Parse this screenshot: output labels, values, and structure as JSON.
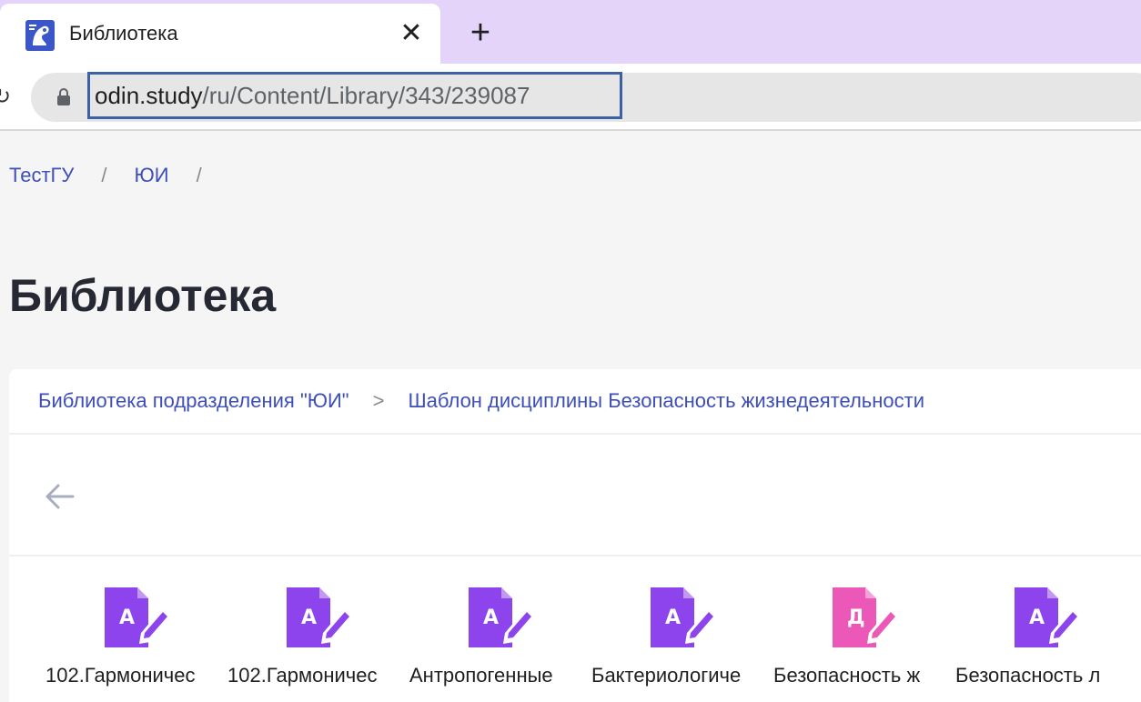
{
  "browser": {
    "tab": {
      "title": "Библиотека",
      "close_glyph": "✕",
      "favicon": "site-logo-icon"
    },
    "new_tab_glyph": "+",
    "address": {
      "host": "odin.study",
      "path": "/ru/Content/Library/343/239087"
    }
  },
  "breadcrumb": {
    "items": [
      "ТестГУ",
      "ЮИ"
    ],
    "separator": "/"
  },
  "page_title": "Библиотека",
  "folder_path": {
    "items": [
      "Библиотека подразделения \"ЮИ\"",
      "Шаблон дисциплины Безопасность жизнедеятельности"
    ],
    "separator": ">"
  },
  "files": [
    {
      "name": "102.Гармоничес",
      "letter": "А",
      "color": "#8e44ec"
    },
    {
      "name": "102.Гармоничес",
      "letter": "А",
      "color": "#8e44ec"
    },
    {
      "name": "Антропогенные",
      "letter": "А",
      "color": "#8e44ec"
    },
    {
      "name": "Бактериологиче",
      "letter": "А",
      "color": "#8e44ec"
    },
    {
      "name": "Безопасность ж",
      "letter": "Д",
      "color": "#ec58b8"
    },
    {
      "name": "Безопасность л",
      "letter": "А",
      "color": "#8e44ec"
    }
  ],
  "colors": {
    "link": "#3e4eb8",
    "tab_strip": "#e4d4f9",
    "url_focus": "#3a62a4"
  }
}
